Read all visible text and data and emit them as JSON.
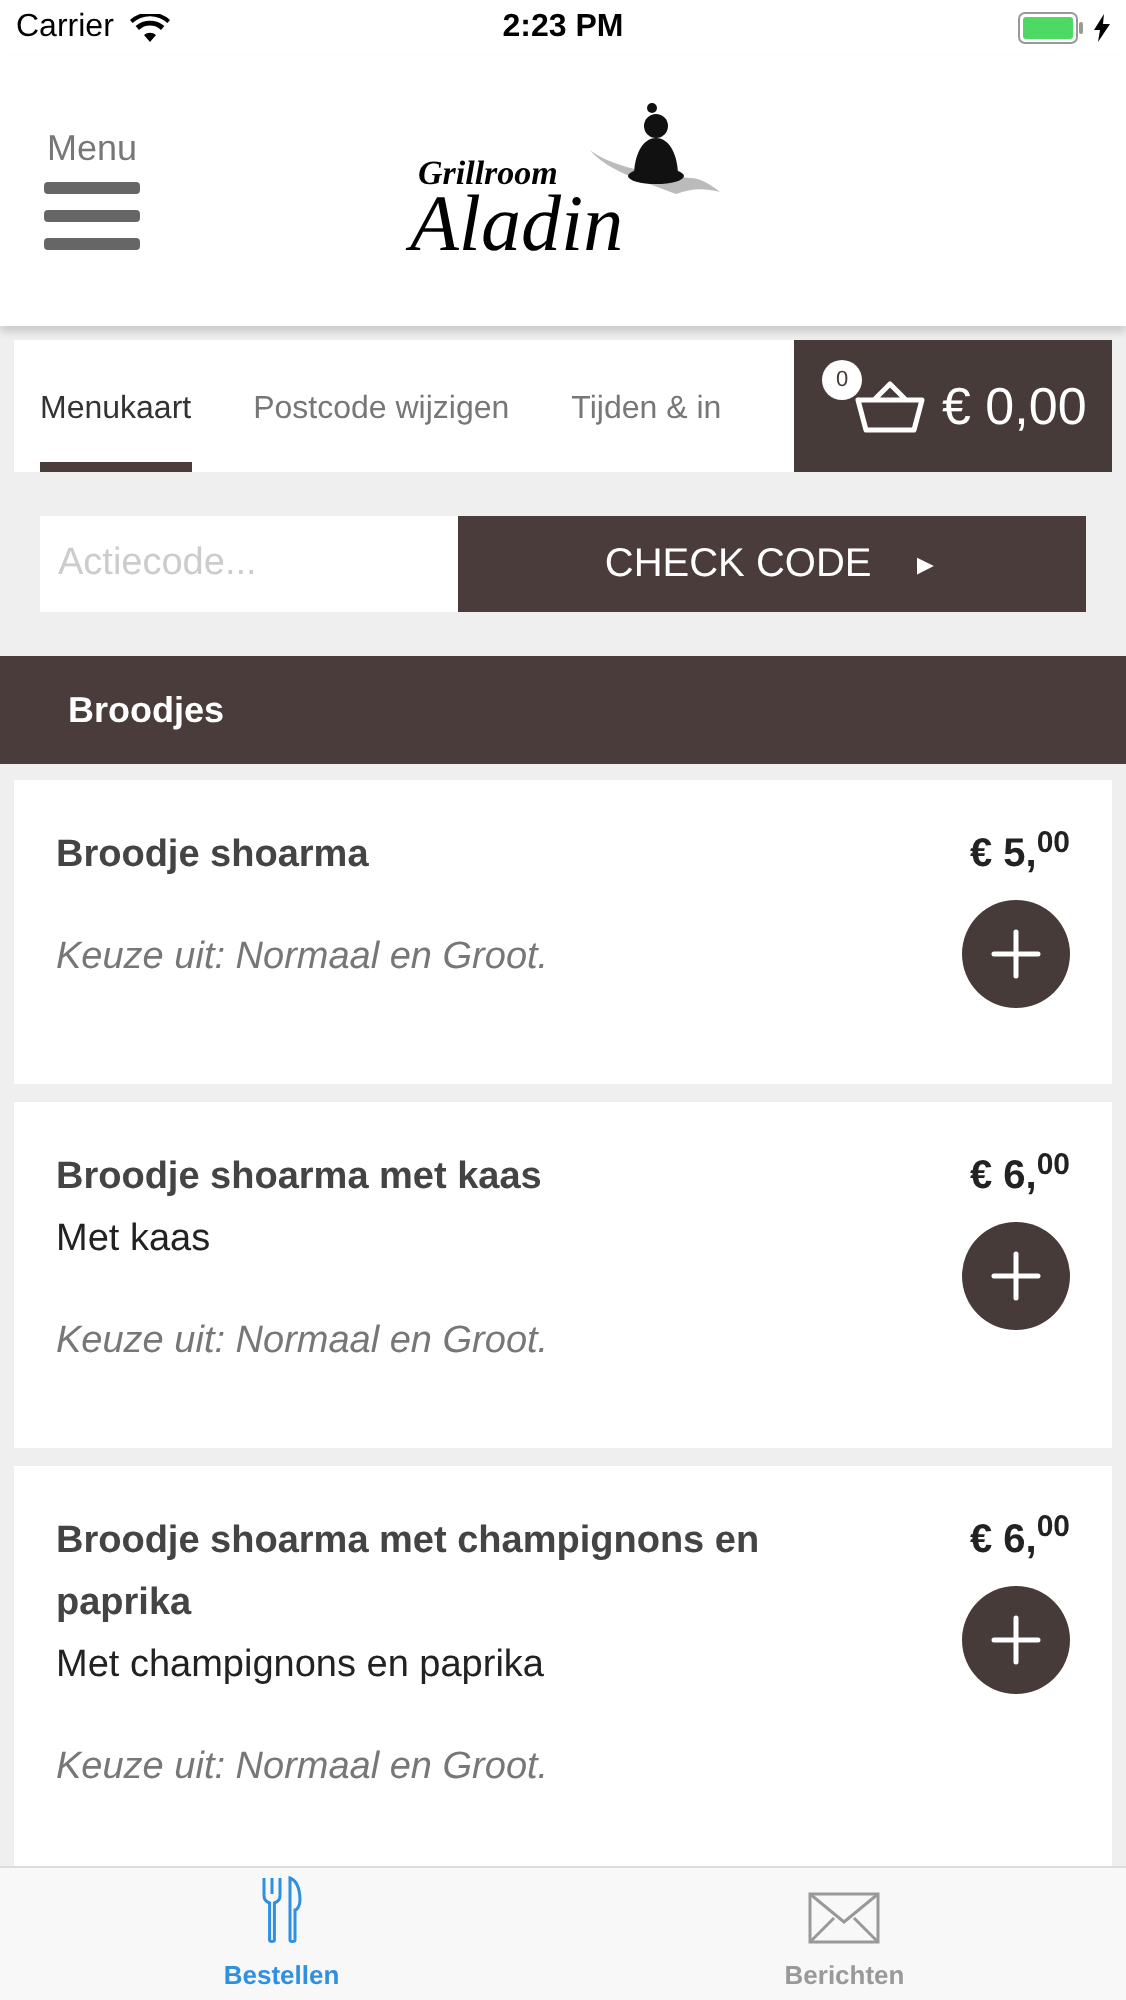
{
  "status_bar": {
    "carrier": "Carrier",
    "time": "2:23 PM"
  },
  "header": {
    "menu_label": "Menu",
    "logo_top": "Grillroom",
    "logo_main": "Aladin"
  },
  "tabs": [
    {
      "label": "Menukaart",
      "selected": true
    },
    {
      "label": "Postcode wijzigen",
      "selected": false
    },
    {
      "label": "Tijden & in",
      "selected": false
    }
  ],
  "cart": {
    "count": "0",
    "total": "€ 0,00"
  },
  "promo": {
    "placeholder": "Actiecode...",
    "button": "CHECK CODE",
    "button_icon": "►"
  },
  "section": {
    "title": "Broodjes"
  },
  "products": [
    {
      "name": "Broodje shoarma",
      "price": "€ 5,$^{00}$",
      "choice": "Keuze uit: Normaal en Groot."
    },
    {
      "name": "Broodje shoarma met kaas",
      "description": "Met kaas",
      "price": "€ 6,$^{00}$",
      "choice": "Keuze uit: Normaal en Groot."
    },
    {
      "name": "Broodje shoarma met champignons en paprika",
      "description": "Met champignons en paprika",
      "price": "€ 6,$^{00}$",
      "choice": "Keuze uit: Normaal en Groot."
    }
  ],
  "tab_bar": [
    {
      "label": "Bestellen",
      "kind": "cutlery",
      "selected": true
    },
    {
      "label": "Berichten",
      "kind": "mail",
      "selected": false
    }
  ]
}
